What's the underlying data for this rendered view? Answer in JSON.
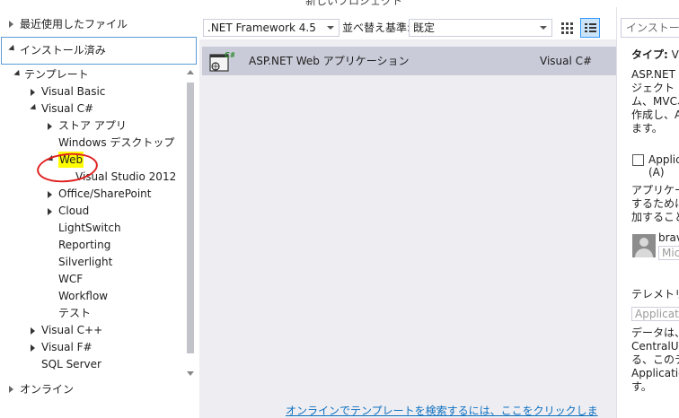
{
  "window": {
    "title": "新しいプロジェクト"
  },
  "left_pane": {
    "recent": "最近使用したファイル",
    "installed": "インストール済み",
    "tree": [
      {
        "label": "テンプレート",
        "indent": 0,
        "toggle": "expanded"
      },
      {
        "label": "Visual Basic",
        "indent": 1,
        "toggle": "collapsed"
      },
      {
        "label": "Visual C#",
        "indent": 1,
        "toggle": "expanded"
      },
      {
        "label": "ストア アプリ",
        "indent": 2,
        "toggle": "collapsed"
      },
      {
        "label": "Windows デスクトップ",
        "indent": 2,
        "toggle": "none"
      },
      {
        "label": "Web",
        "indent": 2,
        "toggle": "expanded",
        "selected": true
      },
      {
        "label": "Visual Studio 2012",
        "indent": 3,
        "toggle": "none"
      },
      {
        "label": "Office/SharePoint",
        "indent": 2,
        "toggle": "collapsed"
      },
      {
        "label": "Cloud",
        "indent": 2,
        "toggle": "collapsed"
      },
      {
        "label": "LightSwitch",
        "indent": 2,
        "toggle": "none"
      },
      {
        "label": "Reporting",
        "indent": 2,
        "toggle": "none"
      },
      {
        "label": "Silverlight",
        "indent": 2,
        "toggle": "none"
      },
      {
        "label": "WCF",
        "indent": 2,
        "toggle": "none"
      },
      {
        "label": "Workflow",
        "indent": 2,
        "toggle": "none"
      },
      {
        "label": "テスト",
        "indent": 2,
        "toggle": "none"
      },
      {
        "label": "Visual C++",
        "indent": 1,
        "toggle": "collapsed"
      },
      {
        "label": "Visual F#",
        "indent": 1,
        "toggle": "collapsed"
      },
      {
        "label": "SQL Server",
        "indent": 1,
        "toggle": "none"
      }
    ],
    "online": "オンライン"
  },
  "toolbar": {
    "framework": ".NET Framework 4.5",
    "sort_label": "並べ替え基準:",
    "sort_value": "既定"
  },
  "templates": [
    {
      "name": "ASP.NET Web アプリケーション",
      "language": "Visual C#",
      "icon_badge": "C#"
    }
  ],
  "footer": {
    "link": "オンラインでテンプレートを検索するには、ここをクリックします。"
  },
  "right_pane": {
    "search_placeholder": "インストール済",
    "type_label": "タイプ:",
    "type_value": "Vis",
    "description": [
      "ASP.NET ア",
      "ジェクト テン",
      "ム、MVC、コ",
      "作成し、ASI",
      "ます。"
    ],
    "checkbox_label": [
      "Applic",
      "(A)"
    ],
    "ai_text": [
      "アプリケーシ",
      "するために、",
      "加することを"
    ],
    "account_name": "brav",
    "account_sub": "Micr",
    "telemetry_label": "テレメトリの送",
    "telemetry_box": "Applicatio",
    "data_text": [
      "データは、'D",
      "CentralUS'",
      "る、このテン",
      "Application",
      "す。"
    ]
  }
}
